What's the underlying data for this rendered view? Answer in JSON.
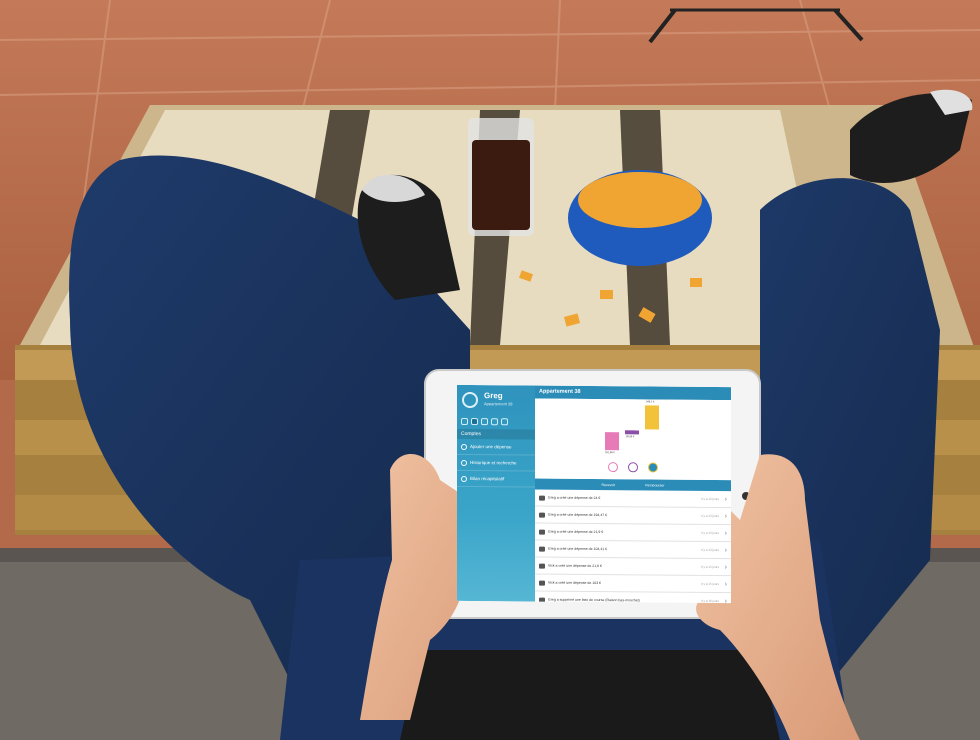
{
  "app": {
    "user_name": "Greg",
    "user_subtitle": "Appartement 38",
    "section_label": "Comptes",
    "menu": [
      {
        "label": "Ajouter une dépense"
      },
      {
        "label": "Historique et recherche"
      },
      {
        "label": "Bilan récapitulatif"
      }
    ],
    "main_title": "Appartement 38",
    "legend": {
      "left": "Recevoir",
      "right": "Rembourser"
    },
    "chart_values": [
      "261,86 €",
      "85,88 €",
      "348,2 €"
    ],
    "activity": [
      {
        "text": "Greg a créé une dépense de 24 €",
        "time": "Il y a 12 jours"
      },
      {
        "text": "Greg a créé une dépense de 194,47 €",
        "time": "Il y a 13 jours"
      },
      {
        "text": "Greg a créé une dépense de 21,9 €",
        "time": "Il y a 13 jours"
      },
      {
        "text": "Greg a créé une dépense de 104,41 €",
        "time": "Il y a 13 jours"
      },
      {
        "text": "Vick a créé une dépense de 21,6 €",
        "time": "Il y a 15 jours"
      },
      {
        "text": "Vick a créé une dépense de 103 €",
        "time": "Il y a 15 jours"
      },
      {
        "text": "Greg a supprimé une liste de course (Raison bas-mouchet)",
        "time": "Il y a 16 jours"
      }
    ]
  },
  "colors": {
    "brand_blue": "#2b8cb8",
    "bar_pink": "#e77bb8",
    "bar_purple": "#8c4fa8",
    "bar_yellow": "#f2c33a"
  }
}
